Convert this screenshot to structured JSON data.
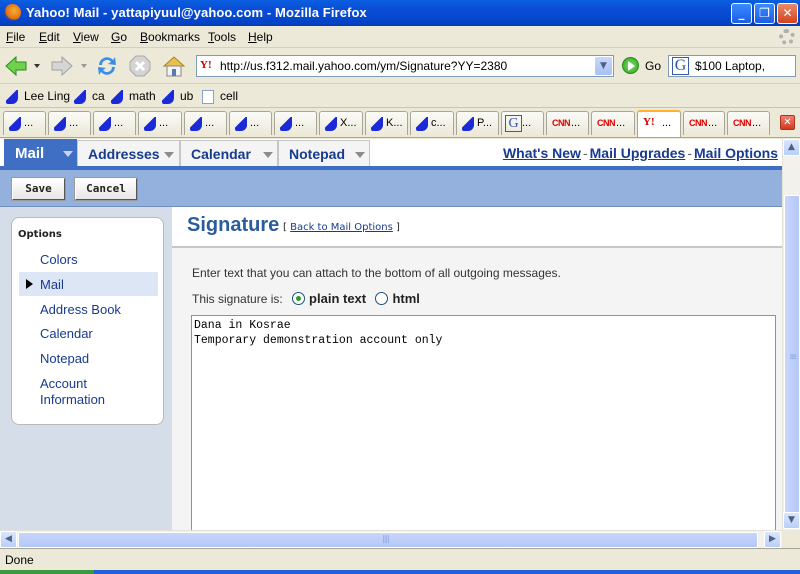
{
  "window": {
    "title": "Yahoo! Mail - yattapiyuul@yahoo.com - Mozilla Firefox",
    "buttons": {
      "minimize": "_",
      "restore": "❐",
      "close": "✕"
    }
  },
  "menu": [
    "File",
    "Edit",
    "View",
    "Go",
    "Bookmarks",
    "Tools",
    "Help"
  ],
  "nav": {
    "url": "http://us.f312.mail.yahoo.com/ym/Signature?YY=2380",
    "site_icon": "Y!",
    "go_label": "Go",
    "search_value": "$100 Laptop,",
    "search_engine_icon": "G"
  },
  "bookmarks": [
    {
      "label": "Lee Ling",
      "icon": "sail-icon"
    },
    {
      "label": "ca",
      "icon": "sail-icon"
    },
    {
      "label": "math",
      "icon": "sail-icon"
    },
    {
      "label": "ub",
      "icon": "sail-icon"
    },
    {
      "label": "cell",
      "icon": "page-icon"
    }
  ],
  "tabs": [
    {
      "label": "...",
      "icon": "sail"
    },
    {
      "label": "...",
      "icon": "sail"
    },
    {
      "label": "...",
      "icon": "sail"
    },
    {
      "label": "...",
      "icon": "sail"
    },
    {
      "label": "...",
      "icon": "sail"
    },
    {
      "label": "...",
      "icon": "sail"
    },
    {
      "label": "...",
      "icon": "sail"
    },
    {
      "label": "X...",
      "icon": "sail"
    },
    {
      "label": "K...",
      "icon": "sail"
    },
    {
      "label": "c...",
      "icon": "sail"
    },
    {
      "label": "P...",
      "icon": "sail"
    },
    {
      "label": "...",
      "icon": "google"
    },
    {
      "label": "...",
      "icon": "cnn"
    },
    {
      "label": "...",
      "icon": "cnn"
    },
    {
      "label": "...",
      "icon": "yahoo",
      "active": true
    },
    {
      "label": "...",
      "icon": "cnn"
    },
    {
      "label": "...",
      "icon": "cnn"
    }
  ],
  "tab_icon_text": {
    "cnn": "CNN",
    "yahoo": "Y!",
    "google": "G"
  },
  "yahoo": {
    "tabs": [
      "Mail",
      "Addresses",
      "Calendar",
      "Notepad"
    ],
    "top_links": [
      "What's New",
      "Mail Upgrades",
      "Mail Options"
    ],
    "link_separator": "-",
    "save_label": "Save",
    "cancel_label": "Cancel",
    "options": {
      "header": "Options",
      "items": [
        "Colors",
        "Mail",
        "Address Book",
        "Calendar",
        "Notepad",
        "Account Information"
      ],
      "selected": "Mail"
    },
    "signature": {
      "title": "Signature",
      "back_open": "[",
      "back_link": "Back to Mail Options",
      "back_close": "]",
      "description": "Enter text that you can attach to the bottom of all outgoing messages.",
      "type_label": "This signature is:",
      "type_options": [
        "plain text",
        "html"
      ],
      "selected_type": "plain text",
      "text": "Dana in Kosrae\nTemporary demonstration account only"
    }
  },
  "status": "Done"
}
